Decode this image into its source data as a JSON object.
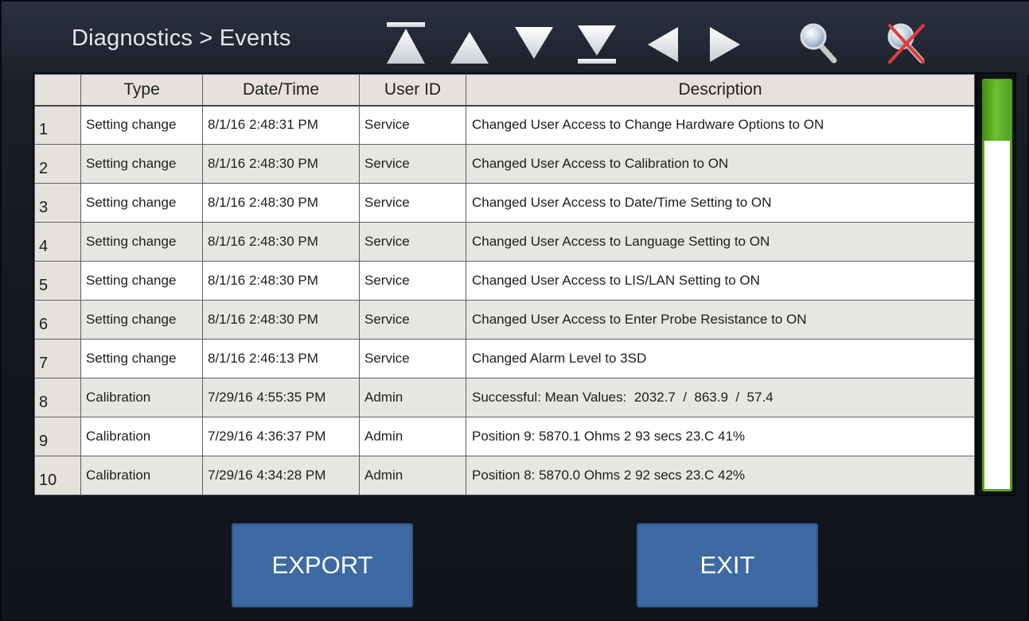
{
  "header": {
    "title": "Diagnostics > Events",
    "toolbar": [
      {
        "icon": "top-icon"
      },
      {
        "icon": "up-icon"
      },
      {
        "icon": "down-icon"
      },
      {
        "icon": "bottom-icon"
      },
      {
        "icon": "left-icon"
      },
      {
        "icon": "right-icon"
      },
      {
        "icon": "search-icon"
      },
      {
        "icon": "clear-search-icon"
      }
    ]
  },
  "table": {
    "columns": [
      "",
      "Type",
      "Date/Time",
      "User ID",
      "Description"
    ],
    "rows": [
      {
        "num": "1",
        "type": "Setting change",
        "datetime": "8/1/16 2:48:31 PM",
        "user": "Service",
        "desc": "Changed User Access to Change Hardware Options to ON"
      },
      {
        "num": "2",
        "type": "Setting change",
        "datetime": "8/1/16 2:48:30 PM",
        "user": "Service",
        "desc": "Changed User Access to Calibration to ON"
      },
      {
        "num": "3",
        "type": "Setting change",
        "datetime": "8/1/16 2:48:30 PM",
        "user": "Service",
        "desc": "Changed User Access to Date/Time Setting to ON"
      },
      {
        "num": "4",
        "type": "Setting change",
        "datetime": "8/1/16 2:48:30 PM",
        "user": "Service",
        "desc": "Changed User Access to Language Setting to ON"
      },
      {
        "num": "5",
        "type": "Setting change",
        "datetime": "8/1/16 2:48:30 PM",
        "user": "Service",
        "desc": "Changed User Access to LIS/LAN Setting to ON"
      },
      {
        "num": "6",
        "type": "Setting change",
        "datetime": "8/1/16 2:48:30 PM",
        "user": "Service",
        "desc": "Changed User Access to Enter Probe Resistance to ON"
      },
      {
        "num": "7",
        "type": "Setting change",
        "datetime": "8/1/16 2:46:13 PM",
        "user": "Service",
        "desc": "Changed Alarm Level to 3SD"
      },
      {
        "num": "8",
        "type": "Calibration",
        "datetime": "7/29/16 4:55:35 PM",
        "user": "Admin",
        "desc": "Successful: Mean Values:  2032.7  /  863.9  /  57.4"
      },
      {
        "num": "9",
        "type": "Calibration",
        "datetime": "7/29/16 4:36:37 PM",
        "user": "Admin",
        "desc": "Position 9: 5870.1 Ohms 2 93 secs 23.C 41%"
      },
      {
        "num": "10",
        "type": "Calibration",
        "datetime": "7/29/16 4:34:28 PM",
        "user": "Admin",
        "desc": "Position 8: 5870.0 Ohms 2 92 secs 23.C 42%"
      }
    ]
  },
  "buttons": {
    "export_label": "EXPORT",
    "exit_label": "EXIT"
  },
  "colors": {
    "button_bg": "#3d6aa3",
    "scroll_accent": "#5aa223",
    "header_bg": "#e5e2dd"
  }
}
